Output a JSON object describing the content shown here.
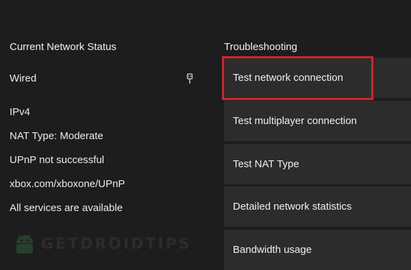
{
  "network_status": {
    "title": "Current Network Status",
    "connection_type": "Wired",
    "connection_icon": "ethernet-icon",
    "lines": [
      "IPv4",
      "NAT Type: Moderate",
      "UPnP not successful",
      "xbox.com/xboxone/UPnP",
      "All services are available"
    ]
  },
  "troubleshooting": {
    "title": "Troubleshooting",
    "items": [
      "Test network connection",
      "Test multiplayer connection",
      "Test NAT Type",
      "Detailed network statistics",
      "Bandwidth usage"
    ],
    "selected_index": 0
  },
  "watermark": {
    "text": "GETDROIDTIPS",
    "icon": "android-logo"
  },
  "colors": {
    "background": "#1d1d1d",
    "tile": "#2c2c2c",
    "focus": "#d8232b"
  }
}
